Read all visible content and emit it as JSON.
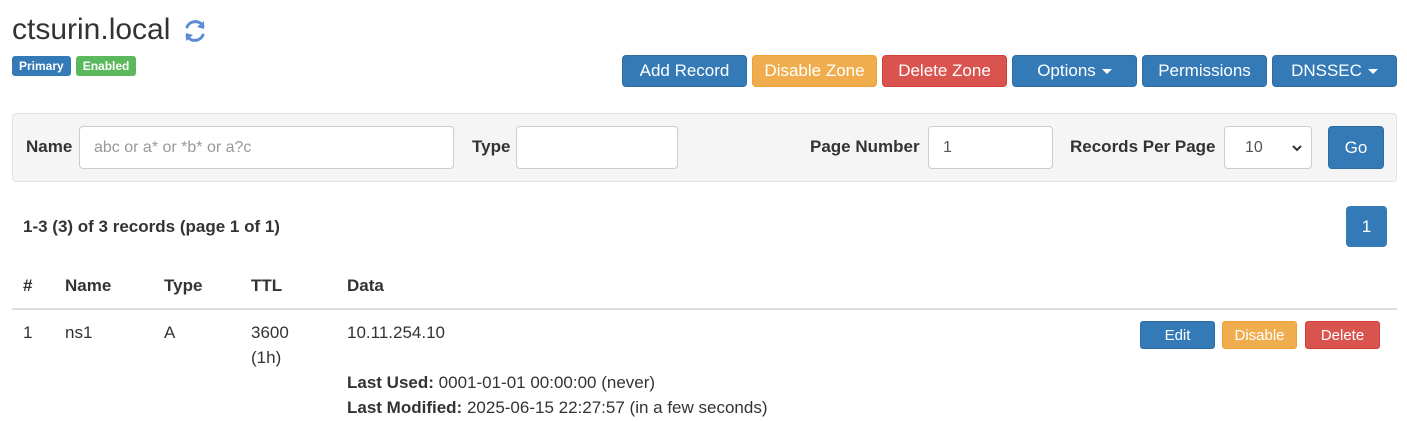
{
  "zone": {
    "name": "ctsurin.local",
    "refresh_icon": "refresh-icon",
    "badges": {
      "type": "Primary",
      "status": "Enabled"
    }
  },
  "toolbar": {
    "add_record": "Add Record",
    "disable_zone": "Disable Zone",
    "delete_zone": "Delete Zone",
    "options": "Options",
    "permissions": "Permissions",
    "dnssec": "DNSSEC"
  },
  "filter": {
    "name_label": "Name",
    "name_placeholder": "abc or a* or *b* or a?c",
    "name_value": "",
    "type_label": "Type",
    "type_value": "",
    "page_number_label": "Page Number",
    "page_number_value": "1",
    "records_per_page_label": "Records Per Page",
    "records_per_page_value": "10",
    "go_label": "Go"
  },
  "summary": "1-3 (3) of 3 records (page 1 of 1)",
  "pagination": {
    "current": "1"
  },
  "table": {
    "headers": {
      "num": "#",
      "name": "Name",
      "type": "Type",
      "ttl": "TTL",
      "data": "Data"
    },
    "rows": [
      {
        "num": "1",
        "name": "ns1",
        "type": "A",
        "ttl": "3600",
        "ttl_human": "(1h)",
        "data": "10.11.254.10",
        "last_used_label": "Last Used:",
        "last_used_value": "0001-01-01 00:00:00 (never)",
        "last_modified_label": "Last Modified:",
        "last_modified_value": "2025-06-15 22:27:57 (in a few seconds)",
        "actions": {
          "edit": "Edit",
          "disable": "Disable",
          "delete": "Delete"
        }
      }
    ]
  },
  "colors": {
    "primary": "#337ab7",
    "success": "#5cb85c",
    "warning": "#f0ad4e",
    "danger": "#d9534f",
    "refresh_icon": "#5b8dd6"
  }
}
